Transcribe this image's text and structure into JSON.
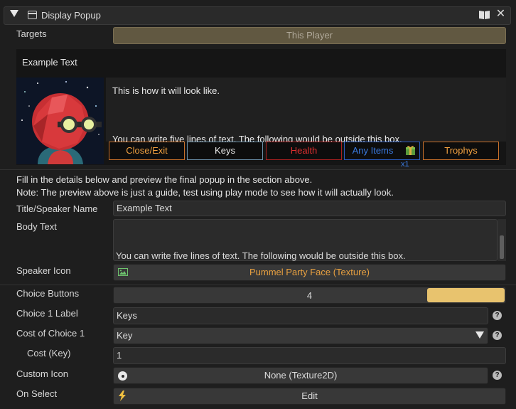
{
  "header": {
    "title": "Display Popup",
    "book_icon": "book-icon",
    "close_glyph": "✕"
  },
  "targets": {
    "label": "Targets",
    "value": "This Player"
  },
  "preview": {
    "title": "Example Text",
    "body_line1": "This is how it will look like.",
    "body_line2": "You can write five lines of text. The following would be outside this box.",
    "choices": [
      {
        "label": "Close/Exit",
        "color": "#f0a040",
        "border": "#c8702a"
      },
      {
        "label": "Keys",
        "color": "#e8e8e8",
        "border": "#6a8fa8"
      },
      {
        "label": "Health",
        "color": "#e03030",
        "border": "#a82020"
      },
      {
        "label": "Any Items",
        "color": "#3a7ae0",
        "border": "#2a5cc0"
      },
      {
        "label": "Trophys",
        "color": "#f0a040",
        "border": "#c8702a"
      }
    ],
    "item_count": "x1"
  },
  "notes": {
    "line1": "Fill in the details below and preview the final popup in the section above.",
    "line2": "Note: The preview above is just a guide, test using play mode to see how it will actually look."
  },
  "form": {
    "title_label": "Title/Speaker Name",
    "title_value": "Example Text",
    "body_label": "Body Text",
    "body_value": "You can write five lines of text. The following would be outside this box.",
    "speaker_icon_label": "Speaker Icon",
    "speaker_icon_value": "Pummel Party Face (Texture)",
    "choice_buttons_label": "Choice Buttons",
    "choice_buttons_value": "4",
    "choice_buttons_fraction": 0.8,
    "choice1_label": "Choice 1 Label",
    "choice1_value": "Keys",
    "cost_label": "Cost of Choice 1",
    "cost_value": "Key",
    "cost_key_label": "Cost (Key)",
    "cost_key_value": "1",
    "custom_icon_label": "Custom Icon",
    "custom_icon_value": "None (Texture2D)",
    "on_select_label": "On Select",
    "on_select_value": "Edit",
    "help_glyph": "?"
  },
  "colors": {
    "accent": "#e8c36e",
    "texture_text": "#e8a040",
    "background": "#1e1e1e"
  }
}
